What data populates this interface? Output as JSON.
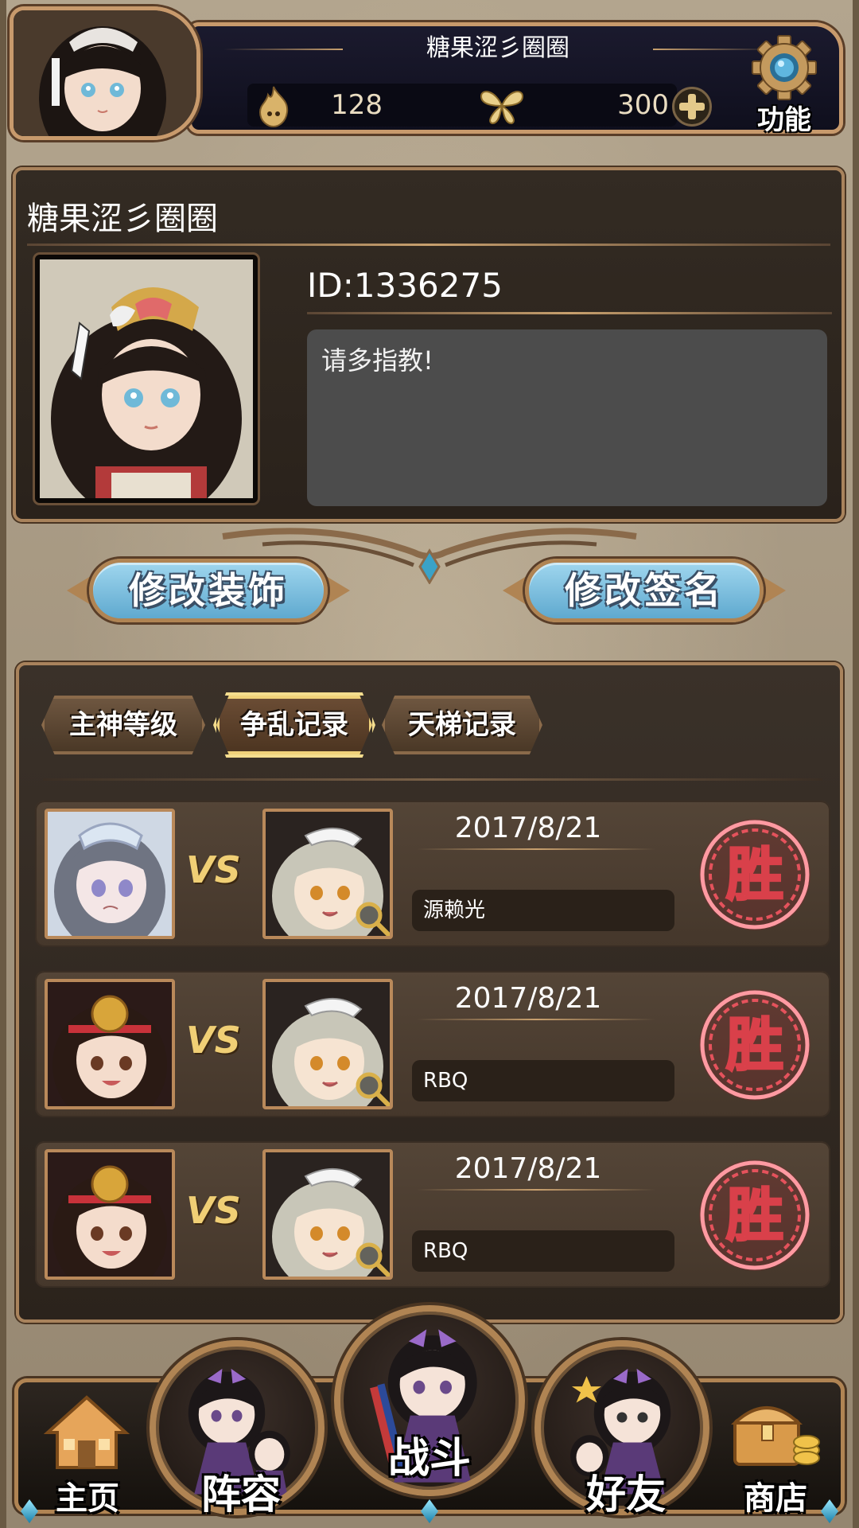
{
  "header": {
    "player_name": "糖果涩彡圈圈",
    "flame_count": "128",
    "butterfly_count": "300",
    "function_label": "功能"
  },
  "profile": {
    "name": "糖果涩彡圈圈",
    "id": "ID:1336275",
    "signature": "请多指教!"
  },
  "actions": {
    "edit_decoration": "修改装饰",
    "edit_signature": "修改签名"
  },
  "tabs": [
    {
      "label": "主神等级",
      "active": false
    },
    {
      "label": "争乱记录",
      "active": true
    },
    {
      "label": "天梯记录",
      "active": false
    }
  ],
  "records": [
    {
      "vs": "VS",
      "date": "2017/8/21",
      "opponent": "源赖光",
      "result": "胜"
    },
    {
      "vs": "VS",
      "date": "2017/8/21",
      "opponent": "RBQ",
      "result": "胜"
    },
    {
      "vs": "VS",
      "date": "2017/8/21",
      "opponent": "RBQ",
      "result": "胜"
    }
  ],
  "nav": {
    "home": "主页",
    "lineup": "阵容",
    "battle": "战斗",
    "friends": "好友",
    "shop": "商店"
  },
  "colors": {
    "accent_blue": "#5fa9cf",
    "frame_gold": "#b08453",
    "win_red": "#d9404a",
    "vs_gold": "#f0cf75"
  }
}
